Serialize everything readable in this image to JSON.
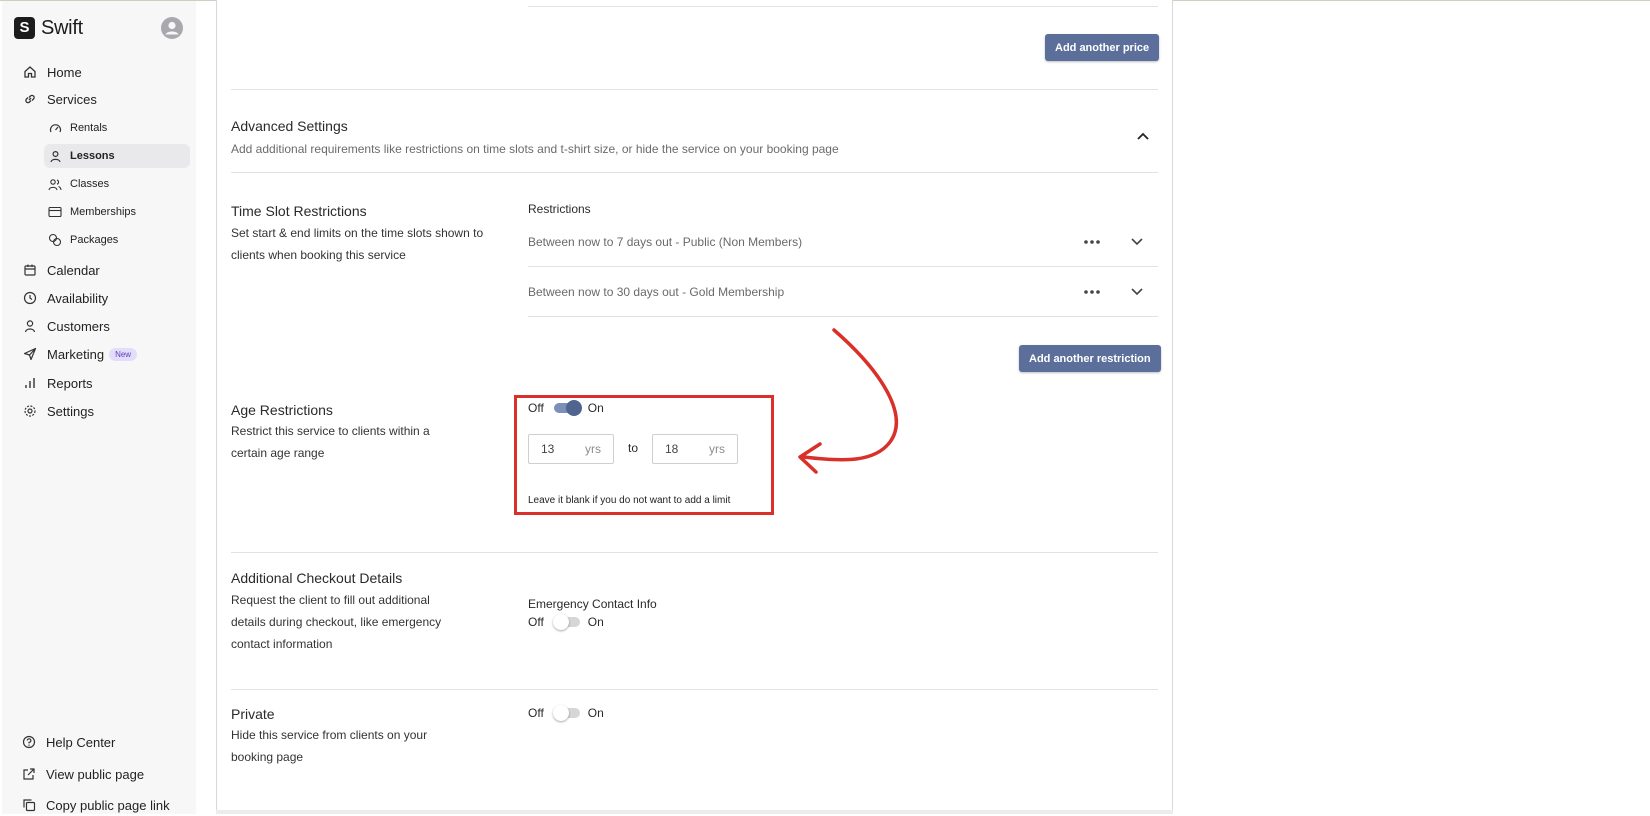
{
  "app": {
    "brand": "Swift",
    "brand_logo_letter": "S"
  },
  "sidebar": {
    "items": [
      {
        "label": "Home",
        "icon": "home-icon"
      },
      {
        "label": "Services",
        "icon": "link-icon"
      },
      {
        "label": "Calendar",
        "icon": "calendar-icon"
      },
      {
        "label": "Availability",
        "icon": "clock-icon"
      },
      {
        "label": "Customers",
        "icon": "user-icon"
      },
      {
        "label": "Marketing",
        "icon": "send-icon",
        "badge": "New"
      },
      {
        "label": "Reports",
        "icon": "bar-chart-icon"
      },
      {
        "label": "Settings",
        "icon": "gear-icon"
      }
    ],
    "services_sub": [
      {
        "label": "Rentals",
        "icon": "gauge-icon"
      },
      {
        "label": "Lessons",
        "icon": "user-icon",
        "active": true
      },
      {
        "label": "Classes",
        "icon": "users-icon"
      },
      {
        "label": "Memberships",
        "icon": "card-icon"
      },
      {
        "label": "Packages",
        "icon": "coins-icon"
      }
    ],
    "footer": [
      {
        "label": "Help Center",
        "icon": "help-circle-icon"
      },
      {
        "label": "View public page",
        "icon": "external-link-icon"
      },
      {
        "label": "Copy public page link",
        "icon": "copy-icon"
      }
    ]
  },
  "main": {
    "add_price_button": "Add another price",
    "advanced": {
      "title": "Advanced Settings",
      "description": "Add additional requirements like restrictions on time slots and t-shirt size, or hide the service on your booking page"
    },
    "time_slot": {
      "title": "Time Slot Restrictions",
      "description": "Set start & end limits on the time slots shown to clients when booking this service",
      "restrictions_label": "Restrictions",
      "rows": [
        "Between now to 7 days out - Public (Non Members)",
        "Between now to 30 days out - Gold Membership"
      ],
      "add_button": "Add another restriction"
    },
    "age": {
      "title": "Age Restrictions",
      "description": "Restrict this service to clients within a certain age range",
      "toggle_off": "Off",
      "toggle_on": "On",
      "enabled": true,
      "min_value": "13",
      "max_value": "18",
      "unit": "yrs",
      "to_label": "to",
      "hint": "Leave it blank if you do not want to add a limit"
    },
    "checkout": {
      "title": "Additional Checkout Details",
      "description": "Request the client to fill out additional details during checkout, like emergency contact information",
      "field_label": "Emergency Contact Info",
      "toggle_off": "Off",
      "toggle_on": "On",
      "enabled": false
    },
    "private": {
      "title": "Private",
      "description": "Hide this service from clients on your booking page",
      "toggle_off": "Off",
      "toggle_on": "On",
      "enabled": false
    }
  },
  "colors": {
    "primary_button": "#5b6f9a",
    "toggle_on": "#4f648f",
    "annotation_red": "#d9302a",
    "badge_bg": "#e4dcfb"
  }
}
